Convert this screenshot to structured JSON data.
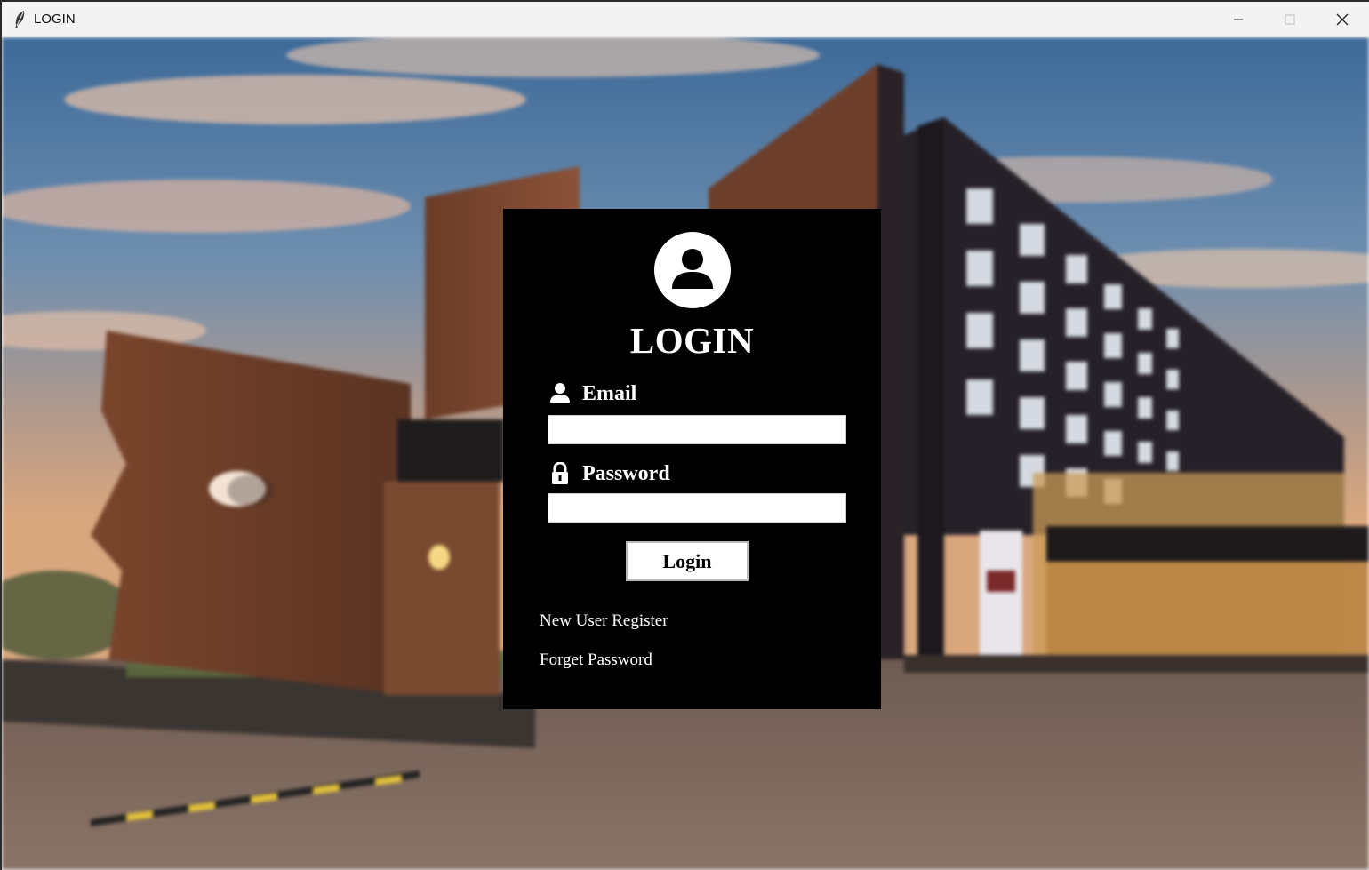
{
  "window": {
    "title": "LOGIN",
    "controls": {
      "minimize": "minimize-icon",
      "maximize": "maximize-icon",
      "close": "close-icon"
    }
  },
  "background": {
    "description_icon": "hotel-building-background"
  },
  "login": {
    "avatar_icon": "user-avatar-icon",
    "heading": "LOGIN",
    "email": {
      "icon": "user-icon",
      "label": "Email",
      "value": "",
      "placeholder": ""
    },
    "password": {
      "icon": "lock-icon",
      "label": "Password",
      "value": "",
      "placeholder": ""
    },
    "submit_label": "Login",
    "links": {
      "register": "New User Register",
      "forgot": "Forget Password"
    }
  },
  "colors": {
    "panel": "#000000",
    "text": "#ffffff",
    "titlebar": "#f3f3f3"
  }
}
